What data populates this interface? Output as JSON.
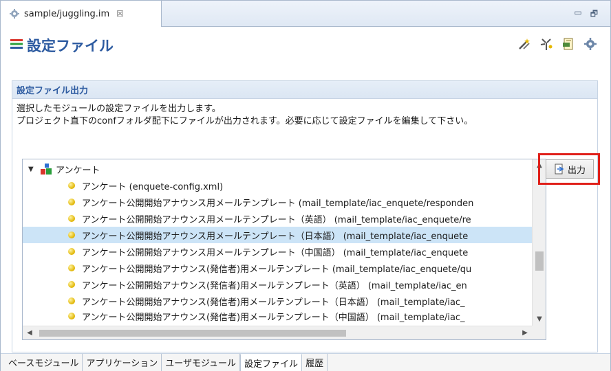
{
  "editor_tab": {
    "title": "sample/juggling.im",
    "close": "☒"
  },
  "window_controls": {
    "minimize": "▭",
    "maximize": "🗗"
  },
  "header": {
    "title": "設定ファイル"
  },
  "toolbar": {
    "icons": [
      "wand-icon",
      "sparkle-icon",
      "export-file-icon",
      "settings-icon"
    ]
  },
  "section": {
    "title": "設定ファイル出力",
    "description": [
      "選択したモジュールの設定ファイルを出力します。",
      "プロジェクト直下のconfフォルダ配下にファイルが出力されます。必要に応じて設定ファイルを編集して下さい。"
    ]
  },
  "tree": {
    "category": "アンケート",
    "items": [
      "アンケート (enquete-config.xml)",
      "アンケート公開開始アナウンス用メールテンプレート (mail_template/iac_enquete/responden",
      "アンケート公開開始アナウンス用メールテンプレート（英語） (mail_template/iac_enquete/re",
      "アンケート公開開始アナウンス用メールテンプレート（日本語） (mail_template/iac_enquete",
      "アンケート公開開始アナウンス用メールテンプレート（中国語） (mail_template/iac_enquete",
      "アンケート公開開始アナウンス(発信者)用メールテンプレート (mail_template/iac_enquete/qu",
      "アンケート公開開始アナウンス(発信者)用メールテンプレート（英語） (mail_template/iac_en",
      "アンケート公開開始アナウンス(発信者)用メールテンプレート（日本語） (mail_template/iac_",
      "アンケート公開開始アナウンス(発信者)用メールテンプレート（中国語） (mail_template/iac_"
    ],
    "selected_index": 3
  },
  "output_button": {
    "label": "出力"
  },
  "bottom_tabs": [
    {
      "label": "ベースモジュール",
      "active": false
    },
    {
      "label": "アプリケーション",
      "active": false
    },
    {
      "label": "ユーザモジュール",
      "active": false
    },
    {
      "label": "設定ファイル",
      "active": true
    },
    {
      "label": "履歴",
      "active": false
    }
  ],
  "colors": {
    "accent": "#2c5aa0",
    "highlight": "#e0201a",
    "selection": "#cce4f7"
  }
}
